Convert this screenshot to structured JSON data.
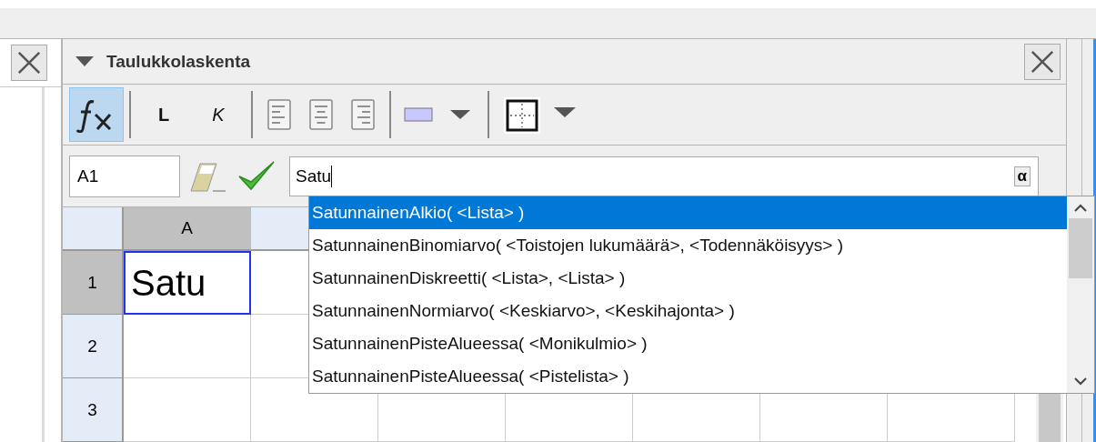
{
  "panel": {
    "title": "Taulukkolaskenta",
    "expanded": true
  },
  "toolbar": [
    {
      "kind": "fx",
      "selected": true
    },
    {
      "kind": "text",
      "label": "L",
      "selected": false
    },
    {
      "kind": "text",
      "label": "K",
      "selected": false
    },
    {
      "kind": "align-left",
      "selected": false
    },
    {
      "kind": "align-center",
      "selected": false
    },
    {
      "kind": "align-right",
      "selected": false
    },
    {
      "kind": "color",
      "color": "#c8c8ff"
    },
    {
      "kind": "border"
    }
  ],
  "input_bar": {
    "cell_name": "A1",
    "value": "Satu",
    "alpha": "α"
  },
  "suggestions": [
    {
      "label": "SatunnainenAlkio( <Lista> )",
      "selected": true
    },
    {
      "label": "SatunnainenBinomiarvo( <Toistojen lukumäärä>, <Todennäköisyys> )",
      "selected": false
    },
    {
      "label": "SatunnainenDiskreetti( <Lista>, <Lista> )",
      "selected": false
    },
    {
      "label": "SatunnainenNormiarvo( <Keskiarvo>, <Keskihajonta> )",
      "selected": false
    },
    {
      "label": "SatunnainenPisteAlueessa( <Monikulmio> )",
      "selected": false
    },
    {
      "label": "SatunnainenPisteAlueessa( <Pistelista> )",
      "selected": false
    }
  ],
  "spreadsheet": {
    "columns": [
      {
        "label": "A",
        "selected": true
      }
    ],
    "rows": [
      {
        "label": "1",
        "selected": true,
        "cells": [
          "Satu"
        ]
      },
      {
        "label": "2",
        "selected": false,
        "cells": []
      },
      {
        "label": "3",
        "selected": false,
        "cells": []
      }
    ]
  }
}
